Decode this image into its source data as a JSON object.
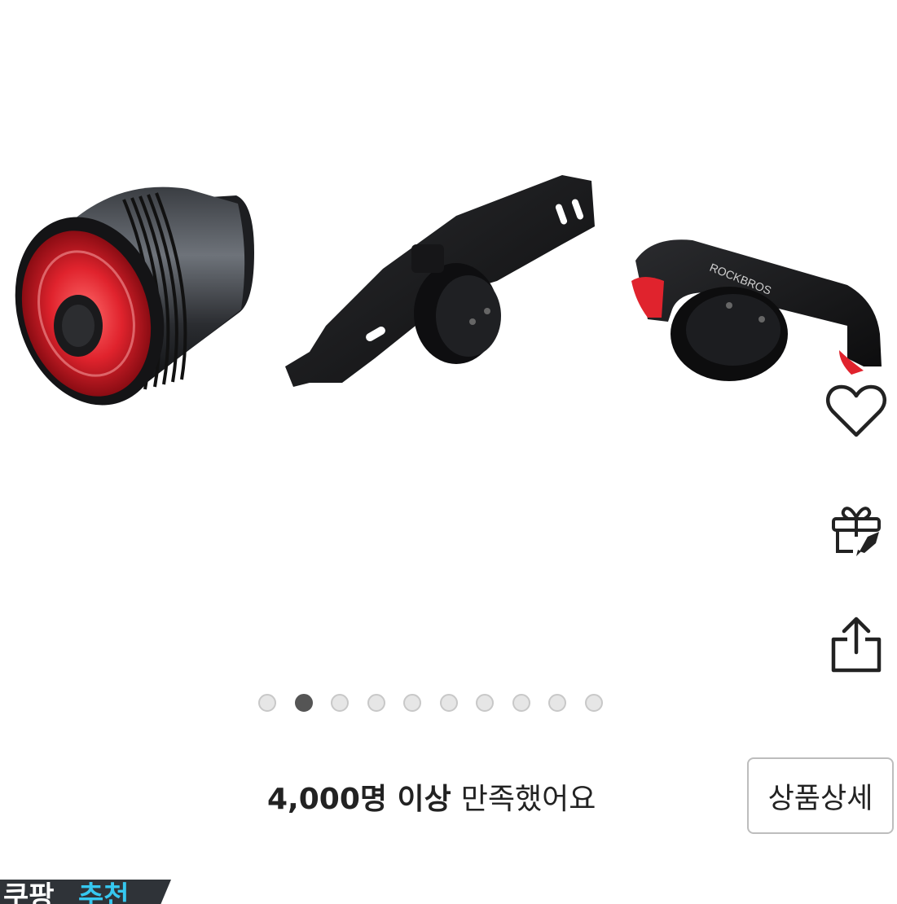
{
  "product_gallery": {
    "image_alt": "Bicycle taillight with mounting brackets",
    "brand_text": "ROCKBROS",
    "total_slides": 10,
    "active_slide": 2
  },
  "actions": {
    "wishlist_icon": "heart-icon",
    "gift_icon": "gift-rocket-icon",
    "share_icon": "share-icon"
  },
  "summary": {
    "count_text": "4,000명 이상",
    "satisfied_text": "만족했어요"
  },
  "detail_button": {
    "label": "상품상세"
  },
  "badge": {
    "part1": "쿠팡",
    "part2": "추천"
  }
}
